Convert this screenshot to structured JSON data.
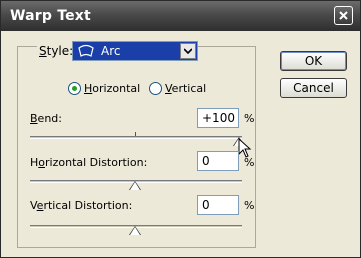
{
  "window": {
    "title": "Warp Text"
  },
  "style": {
    "label_prefix": "S",
    "label_rest": "tyle:",
    "selected": "Arc",
    "shape_icon": "arc-shape-icon"
  },
  "orientation": {
    "horizontal_u": "H",
    "horizontal_rest": "orizontal",
    "vertical_u": "V",
    "vertical_rest": "ertical",
    "selected": "Horizontal"
  },
  "bend": {
    "label_u": "B",
    "label_rest": "end:",
    "value": "+100",
    "unit": "%",
    "slider_fraction": 1.0
  },
  "horizontal_distortion": {
    "label_pre": "H",
    "label_u": "o",
    "label_rest": "rizontal Distortion:",
    "value": "0",
    "unit": "%",
    "slider_fraction": 0.5
  },
  "vertical_distortion": {
    "label_pre": "V",
    "label_u": "e",
    "label_rest": "rtical Distortion:",
    "value": "0",
    "unit": "%",
    "slider_fraction": 0.5
  },
  "buttons": {
    "ok": "OK",
    "cancel": "Cancel"
  }
}
